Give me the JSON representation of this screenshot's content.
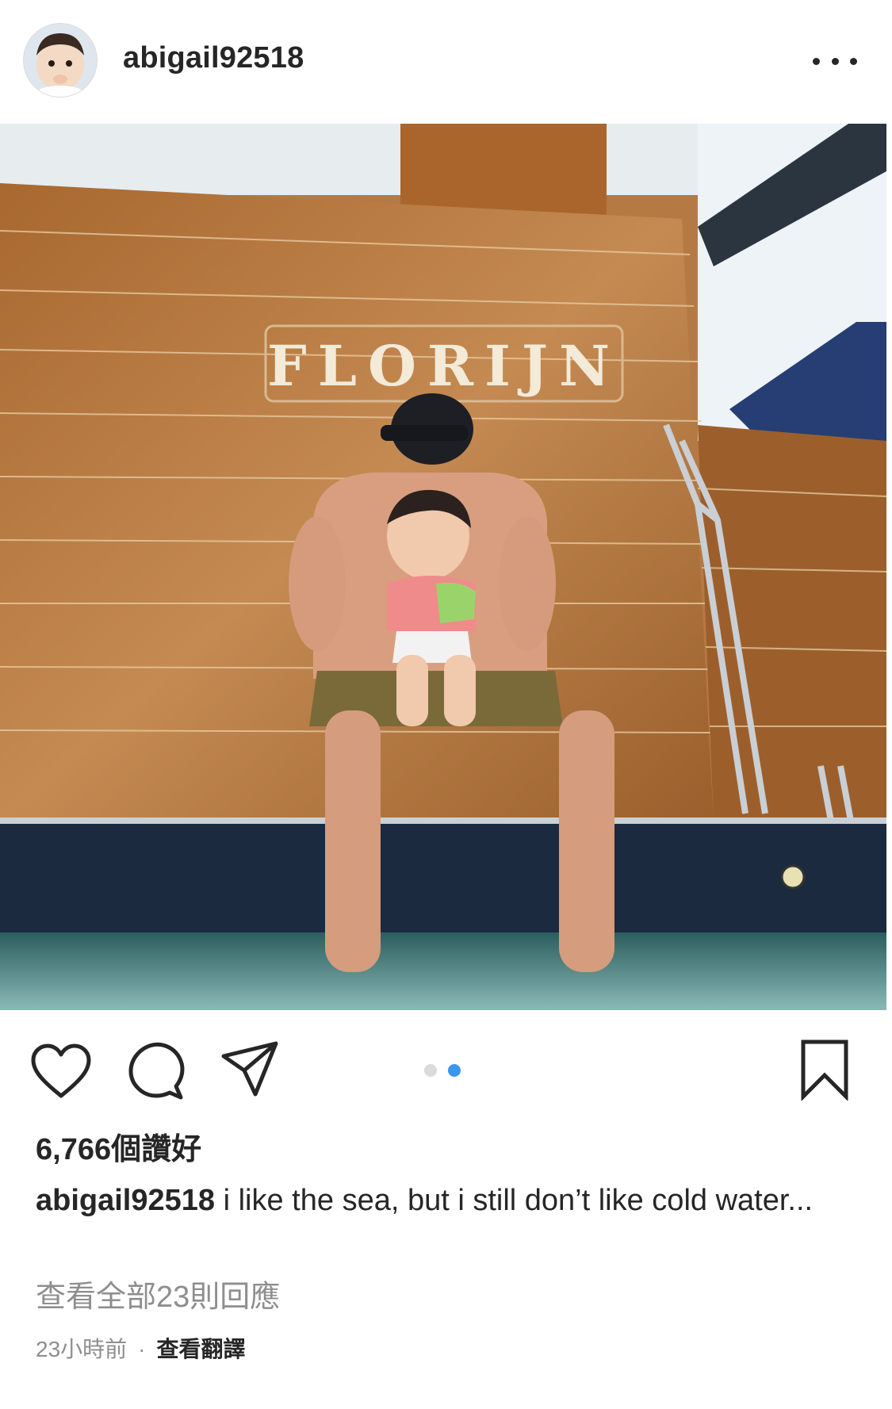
{
  "post": {
    "username": "abigail92518",
    "avatar_icon": "profile-avatar",
    "photo_text": "FLORIJN",
    "likes": "6,766個讚好",
    "caption_user": "abigail92518",
    "caption_text": "i like the sea, but i still don’t like cold water...",
    "view_comments": "查看全部23則回應",
    "time": "23小時前",
    "separator": "·",
    "translate": "查看翻譯"
  },
  "carousel": {
    "total": 2,
    "active": 2
  },
  "colors": {
    "text": "#262626",
    "muted": "#8e8e8e",
    "dot_active": "#3897f0",
    "dot_inactive": "#dbdbdb",
    "wood": "#b57a44",
    "hull": "#1c2a3f",
    "water": "#2f6b6a"
  },
  "icons": [
    "heart-icon",
    "comment-icon",
    "share-icon",
    "bookmark-icon",
    "more-icon"
  ]
}
